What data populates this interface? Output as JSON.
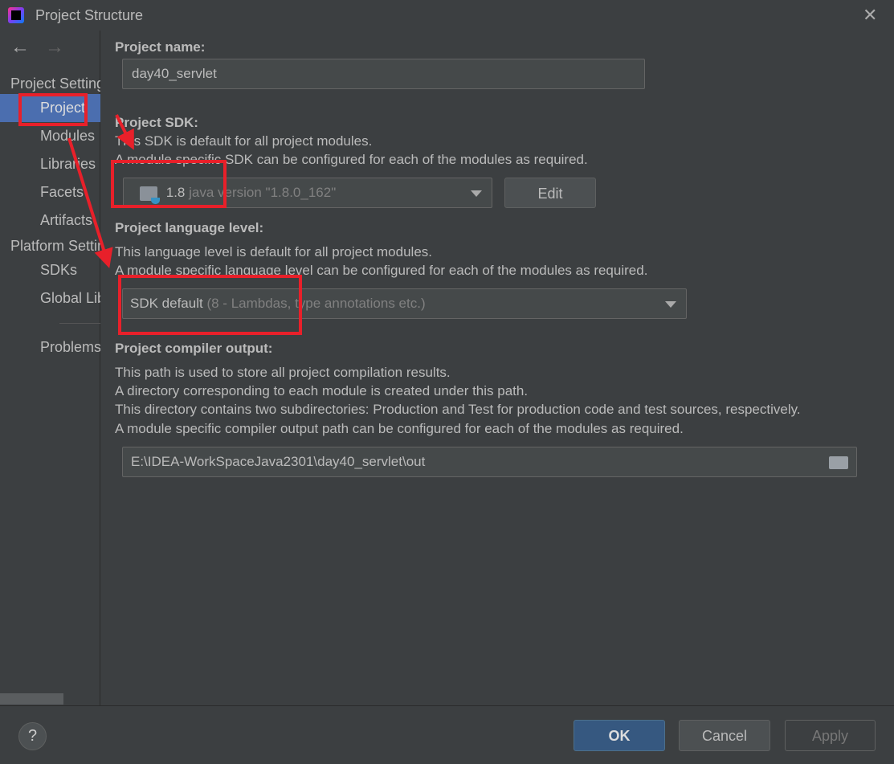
{
  "window": {
    "title": "Project Structure",
    "close": "✕"
  },
  "nav": {
    "back": "←",
    "forward": "→"
  },
  "sidebar": {
    "project_settings": "Project Settings",
    "items": [
      {
        "label": "Project"
      },
      {
        "label": "Modules"
      },
      {
        "label": "Libraries"
      },
      {
        "label": "Facets"
      },
      {
        "label": "Artifacts"
      }
    ],
    "platform_settings": "Platform Settings",
    "platform_items": [
      {
        "label": "SDKs"
      },
      {
        "label": "Global Libraries"
      }
    ],
    "problems": "Problems"
  },
  "main": {
    "name_label": "Project name:",
    "name_value": "day40_servlet",
    "sdk_label": "Project SDK:",
    "sdk_desc1": "This SDK is default for all project modules.",
    "sdk_desc2": "A module specific SDK can be configured for each of the modules as required.",
    "sdk_version": "1.8",
    "sdk_detail": "java version \"1.8.0_162\"",
    "edit": "Edit",
    "lang_label": "Project language level:",
    "lang_desc1": "This language level is default for all project modules.",
    "lang_desc2": "A module specific language level can be configured for each of the modules as required.",
    "lang_value": "SDK default",
    "lang_detail": "(8 - Lambdas, type annotations etc.)",
    "out_label": "Project compiler output:",
    "out_desc1": "This path is used to store all project compilation results.",
    "out_desc2": "A directory corresponding to each module is created under this path.",
    "out_desc3": "This directory contains two subdirectories: Production and Test for production code and test sources, respectively.",
    "out_desc4": "A module specific compiler output path can be configured for each of the modules as required.",
    "out_value": "E:\\IDEA-WorkSpaceJava2301\\day40_servlet\\out"
  },
  "footer": {
    "help": "?",
    "ok": "OK",
    "cancel": "Cancel",
    "apply": "Apply"
  },
  "colors": {
    "annotation": "#e8202a",
    "selection": "#4b6eaf",
    "ok": "#365880"
  }
}
